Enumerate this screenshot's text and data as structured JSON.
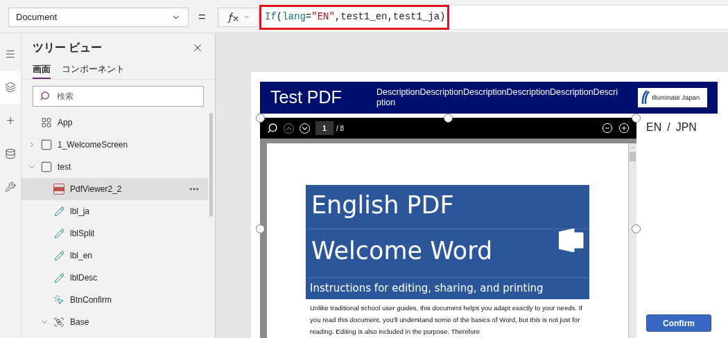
{
  "property_dropdown": {
    "value": "Document"
  },
  "equals_sign": "=",
  "formula": {
    "tokens": [
      {
        "kind": "function",
        "text": "If"
      },
      {
        "kind": "plain",
        "text": "("
      },
      {
        "kind": "variable",
        "text": "lang"
      },
      {
        "kind": "plain",
        "text": "="
      },
      {
        "kind": "string",
        "text": "\"EN\""
      },
      {
        "kind": "plain",
        "text": ",test1_en,test1_ja)"
      }
    ],
    "highlighted": true
  },
  "rail": [
    {
      "kind": "menu",
      "selected": false
    },
    {
      "kind": "layers",
      "selected": true
    },
    {
      "kind": "insert",
      "selected": false
    },
    {
      "kind": "data",
      "selected": false
    },
    {
      "kind": "tools",
      "selected": false
    }
  ],
  "tree_panel": {
    "title": "ツリー ビュー",
    "tabs": [
      {
        "label": "画面",
        "selected": true
      },
      {
        "label": "コンポーネント",
        "selected": false
      }
    ],
    "search": {
      "placeholder": "検索"
    },
    "items": [
      {
        "kind": "app",
        "label": "App",
        "selected": false
      },
      {
        "kind": "screen",
        "label": "1_WelcomeScreen",
        "expanded": false,
        "selected": false
      },
      {
        "kind": "screen",
        "label": "test",
        "expanded": true,
        "selected": false,
        "children": [
          {
            "kind": "pdf",
            "label": "PdfViewer2_2",
            "selected": true
          },
          {
            "kind": "label",
            "label": "lbl_ja",
            "selected": false
          },
          {
            "kind": "label",
            "label": "lblSplit",
            "selected": false
          },
          {
            "kind": "label",
            "label": "lbl_en",
            "selected": false
          },
          {
            "kind": "label",
            "label": "lblDesc",
            "selected": false
          },
          {
            "kind": "button",
            "label": "BtnConfirm",
            "selected": false
          },
          {
            "kind": "group",
            "label": "Base",
            "expanded": true,
            "selected": false
          }
        ]
      }
    ]
  },
  "canvas": {
    "header": {
      "title": "Test PDF",
      "description": "DescriptionDescriptionDescriptionDescriptionDescriptionDescription",
      "logo_text": "Illuminate Japan"
    },
    "pdf_viewer": {
      "page": "1",
      "page_count": "/ 8",
      "document": {
        "title_lines": [
          "English PDF",
          "Welcome Word"
        ],
        "subtitle": "Instructions for editing, sharing, and printing",
        "body": "Unlike traditional school user guides, this document helps you adapt exactly to your needs. If you read this document, you'll understand some of the basics of Word, but this is not just for reading. Editing is also included in the purpose. Therefore"
      }
    },
    "language_switch": {
      "options": [
        "EN",
        "JPN"
      ],
      "separator": "/"
    },
    "confirm_button": "Confirm"
  }
}
